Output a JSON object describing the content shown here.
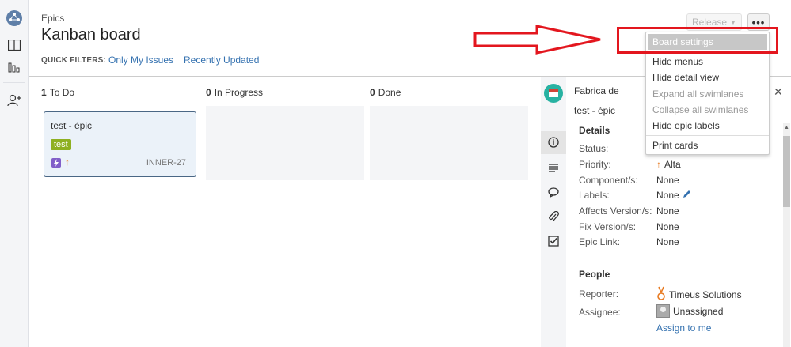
{
  "header": {
    "breadcrumb": "Epics",
    "title": "Kanban board",
    "quick_filters_label": "QUICK FILTERS:",
    "quick_filters": [
      "Only My Issues",
      "Recently Updated"
    ],
    "release_label": "Release",
    "more_label": "•••"
  },
  "menu": {
    "items": [
      "Board settings",
      "Hide menus",
      "Hide detail view",
      "Expand all swimlanes",
      "Collapse all swimlanes",
      "Hide epic labels",
      "Print cards"
    ]
  },
  "columns": [
    {
      "count": "1",
      "name": "To Do"
    },
    {
      "count": "0",
      "name": "In Progress"
    },
    {
      "count": "0",
      "name": "Done"
    }
  ],
  "card": {
    "summary": "test - épic",
    "label": "test",
    "key": "INNER-27"
  },
  "detail": {
    "project": "Fabrica de Softwa",
    "summary": "test - épic",
    "details_heading": "Details",
    "people_heading": "People",
    "fields": {
      "status_label": "Status:",
      "priority_label": "Priority:",
      "priority_value": "Alta",
      "component_label": "Component/s:",
      "component_value": "None",
      "labels_label": "Labels:",
      "labels_value": "None",
      "affects_label": "Affects Version/s:",
      "affects_value": "None",
      "fix_label": "Fix Version/s:",
      "fix_value": "None",
      "epic_label": "Epic Link:",
      "epic_value": "None",
      "reporter_label": "Reporter:",
      "reporter_value": "Timeus Solutions",
      "assignee_label": "Assignee:",
      "assignee_value": "Unassigned",
      "assign_to_me": "Assign to me"
    }
  },
  "colors": {
    "accent": "#3572b0",
    "annotation": "#e3161e",
    "label_green": "#8eb021",
    "priority_orange": "#e87b22"
  }
}
